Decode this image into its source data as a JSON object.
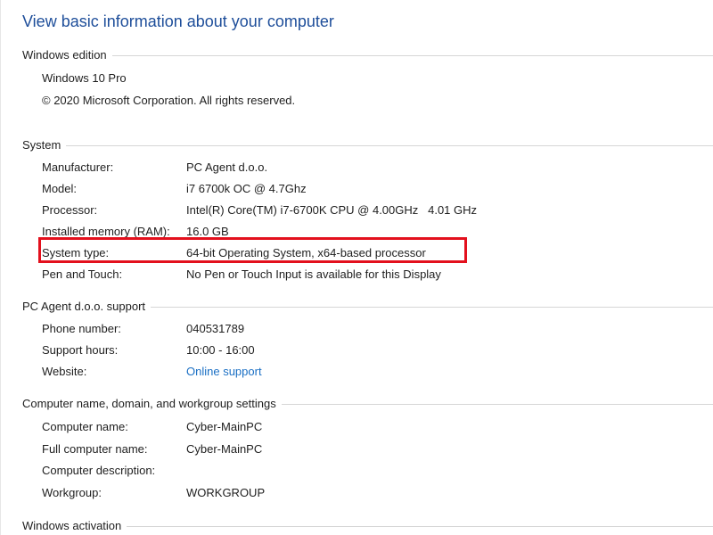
{
  "page_title": "View basic information about your computer",
  "accent_color": "#1e4e9a",
  "link_color": "#1a6fc4",
  "highlight_color": "#e3101d",
  "windows_edition": {
    "heading": "Windows edition",
    "edition": "Windows 10 Pro",
    "copyright": "© 2020 Microsoft Corporation. All rights reserved."
  },
  "system": {
    "heading": "System",
    "rows": [
      {
        "label": "Manufacturer:",
        "value": "PC Agent d.o.o."
      },
      {
        "label": "Model:",
        "value": "i7 6700k OC @ 4.7Ghz"
      },
      {
        "label": "Processor:",
        "value": "Intel(R) Core(TM) i7-6700K CPU @ 4.00GHz   4.01 GHz"
      },
      {
        "label": "Installed memory (RAM):",
        "value": "16.0 GB"
      },
      {
        "label": "System type:",
        "value": "64-bit Operating System, x64-based processor"
      },
      {
        "label": "Pen and Touch:",
        "value": "No Pen or Touch Input is available for this Display"
      }
    ]
  },
  "support": {
    "heading": "PC Agent d.o.o. support",
    "rows": [
      {
        "label": "Phone number:",
        "value": "040531789"
      },
      {
        "label": "Support hours:",
        "value": "10:00 - 16:00"
      },
      {
        "label": "Website:",
        "value": "Online support"
      }
    ]
  },
  "computer_name": {
    "heading": "Computer name, domain, and workgroup settings",
    "rows": [
      {
        "label": "Computer name:",
        "value": "Cyber-MainPC"
      },
      {
        "label": "Full computer name:",
        "value": "Cyber-MainPC"
      },
      {
        "label": "Computer description:",
        "value": ""
      },
      {
        "label": "Workgroup:",
        "value": "WORKGROUP"
      }
    ]
  },
  "activation": {
    "heading": "Windows activation"
  }
}
